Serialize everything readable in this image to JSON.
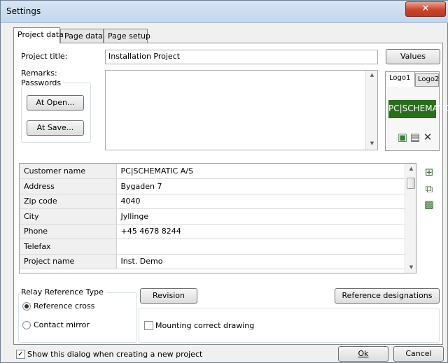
{
  "window": {
    "title": "Settings",
    "close_glyph": "✕"
  },
  "tabs": [
    {
      "label": "Project data"
    },
    {
      "label": "Page data"
    },
    {
      "label": "Page setup"
    }
  ],
  "project": {
    "title_label": "Project title:",
    "title_value": "Installation Project",
    "values_button": "Values",
    "remarks_label": "Remarks:",
    "passwords_label": "Passwords",
    "at_open_button": "At Open...",
    "at_save_button": "At Save..."
  },
  "logo": {
    "tabs": [
      "Logo1",
      "Logo2"
    ],
    "image_text": "PC|SCHEMATIC",
    "brand_color": "#2a6e1d"
  },
  "customer_table": {
    "rows": [
      {
        "key": "Customer name",
        "value": "PC|SCHEMATIC A/S"
      },
      {
        "key": "Address",
        "value": "Bygaden 7"
      },
      {
        "key": "Zip code",
        "value": "4040"
      },
      {
        "key": "City",
        "value": "Jyllinge"
      },
      {
        "key": "Phone",
        "value": "+45 4678 8244"
      },
      {
        "key": "Telefax",
        "value": ""
      },
      {
        "key": "Project name",
        "value": "Inst. Demo"
      }
    ]
  },
  "relay": {
    "group_label": "Relay Reference Type",
    "options": [
      "Reference cross",
      "Contact mirror"
    ],
    "selected": "Reference cross"
  },
  "revision_button": "Revision",
  "reference_designations_button": "Reference designations",
  "mounting_checkbox_label": "Mounting correct drawing",
  "mounting_checked": false,
  "show_dialog_label": "Show this dialog when creating a new project",
  "show_dialog_checked": true,
  "ok_button": "Ok",
  "cancel_button": "Cancel",
  "icons": [
    "logo-import-icon",
    "logo-save-icon",
    "logo-delete-icon",
    "new-record-icon",
    "copy-record-icon",
    "paste-record-icon"
  ]
}
